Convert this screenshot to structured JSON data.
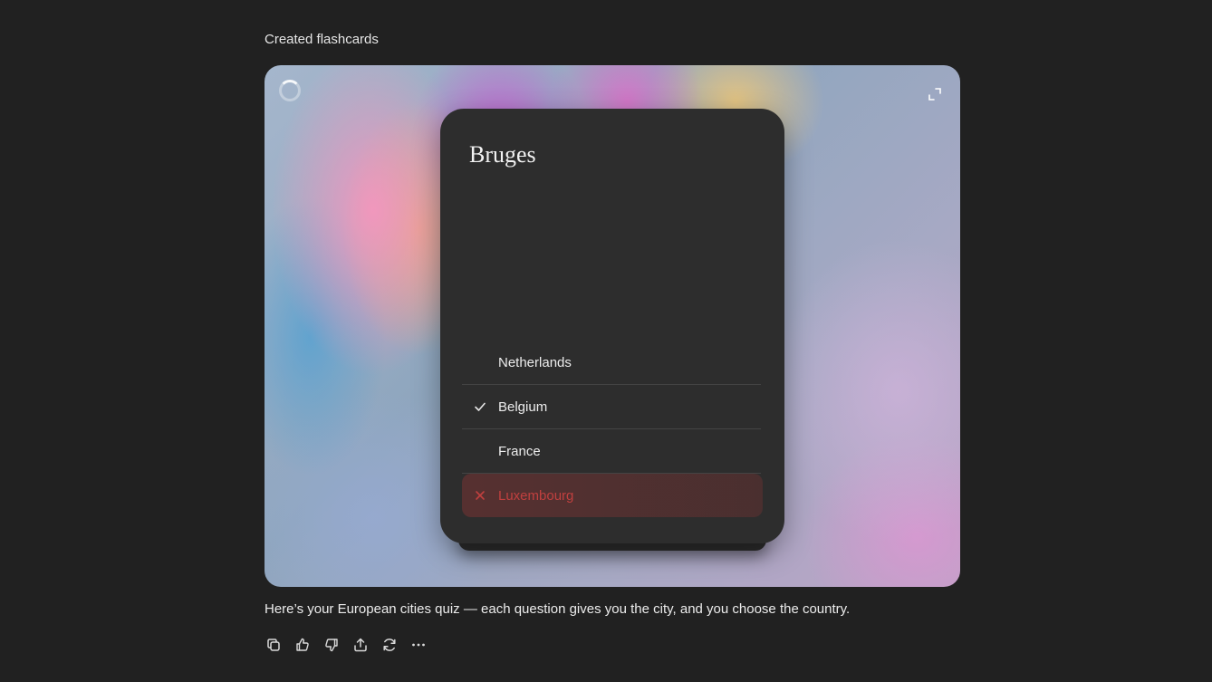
{
  "header": {
    "label": "Created flashcards"
  },
  "card": {
    "title": "Bruges",
    "options": [
      {
        "label": "Netherlands",
        "state": "none"
      },
      {
        "label": "Belgium",
        "state": "correct"
      },
      {
        "label": "France",
        "state": "none"
      },
      {
        "label": "Luxembourg",
        "state": "wrong"
      }
    ]
  },
  "message": "Here’s your European cities quiz — each question gives you the city, and you choose the country.",
  "icons": {
    "spinner": "loading-spinner-icon",
    "expand": "expand-icon",
    "check": "check-icon",
    "wrong": "x-mark-icon",
    "actions": [
      "copy-icon",
      "thumbs-up-icon",
      "thumbs-down-icon",
      "share-icon",
      "regenerate-icon",
      "more-icon"
    ]
  },
  "colors": {
    "background": "#212121",
    "card": "#2d2d2d",
    "wrong": "#c0403f"
  }
}
